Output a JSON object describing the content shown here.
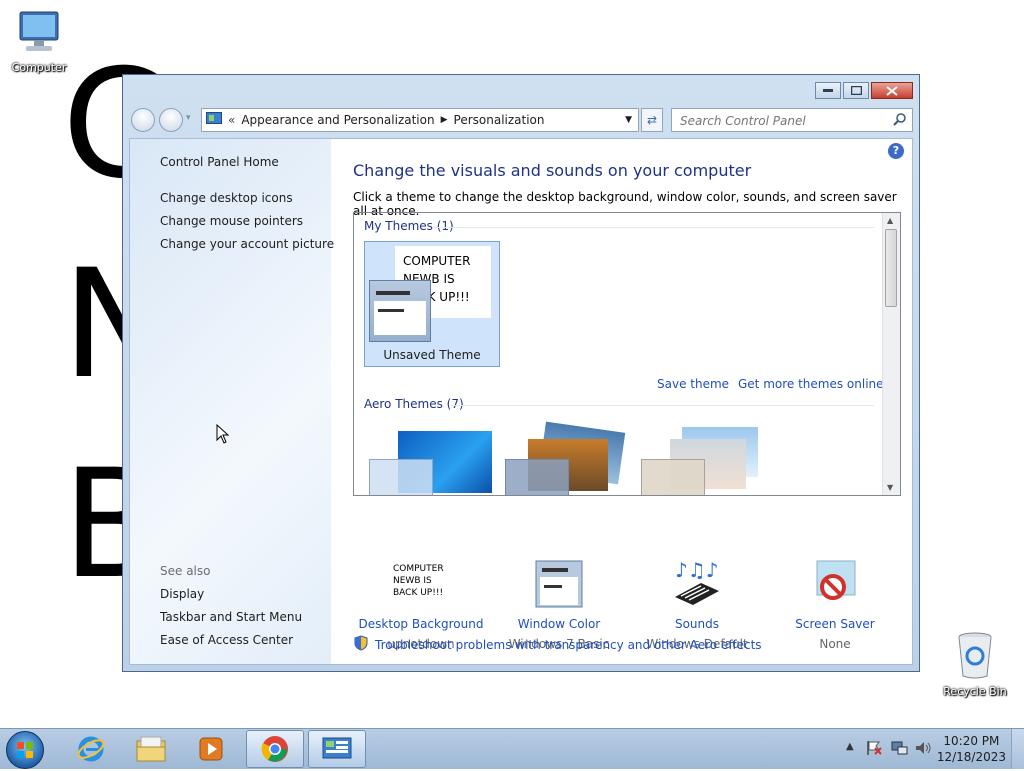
{
  "background_text": [
    "C",
    "N",
    "B"
  ],
  "desktop": {
    "computer_label": "Computer",
    "recycle_label": "Recycle Bin"
  },
  "window": {
    "breadcrumb_parent": "Appearance and Personalization",
    "breadcrumb_current": "Personalization",
    "search_placeholder": "Search Control Panel"
  },
  "left_pane": {
    "home": "Control Panel Home",
    "links": [
      "Change desktop icons",
      "Change mouse pointers",
      "Change your account picture"
    ],
    "see_also_label": "See also",
    "see_also": [
      "Display",
      "Taskbar and Start Menu",
      "Ease of Access Center"
    ]
  },
  "main": {
    "heading": "Change the visuals and sounds on your computer",
    "subheading": "Click a theme to change the desktop background, window color, sounds, and screen saver all at once.",
    "my_themes_title": "My Themes (1)",
    "unsaved_theme_text": "COMPUTER NEWB IS BACK UP!!!",
    "unsaved_theme_label": "Unsaved Theme",
    "save_theme": "Save theme",
    "get_more": "Get more themes online",
    "aero_title": "Aero Themes (7)"
  },
  "bottom": {
    "items": [
      {
        "title": "Desktop Background",
        "subtitle": "upnotdown",
        "thumb_text": "COMPUTER NEWB IS BACK UP!!!"
      },
      {
        "title": "Window Color",
        "subtitle": "Windows 7 Basic"
      },
      {
        "title": "Sounds",
        "subtitle": "Windows Default"
      },
      {
        "title": "Screen Saver",
        "subtitle": "None"
      }
    ],
    "troubleshoot": "Troubleshoot problems with transparency and other Aero effects"
  },
  "taskbar": {
    "time": "10:20 PM",
    "date": "12/18/2023"
  },
  "colors": {
    "link": "#1f4fbf",
    "heading": "#1e3287",
    "window_frame": "#bcd1e8"
  }
}
